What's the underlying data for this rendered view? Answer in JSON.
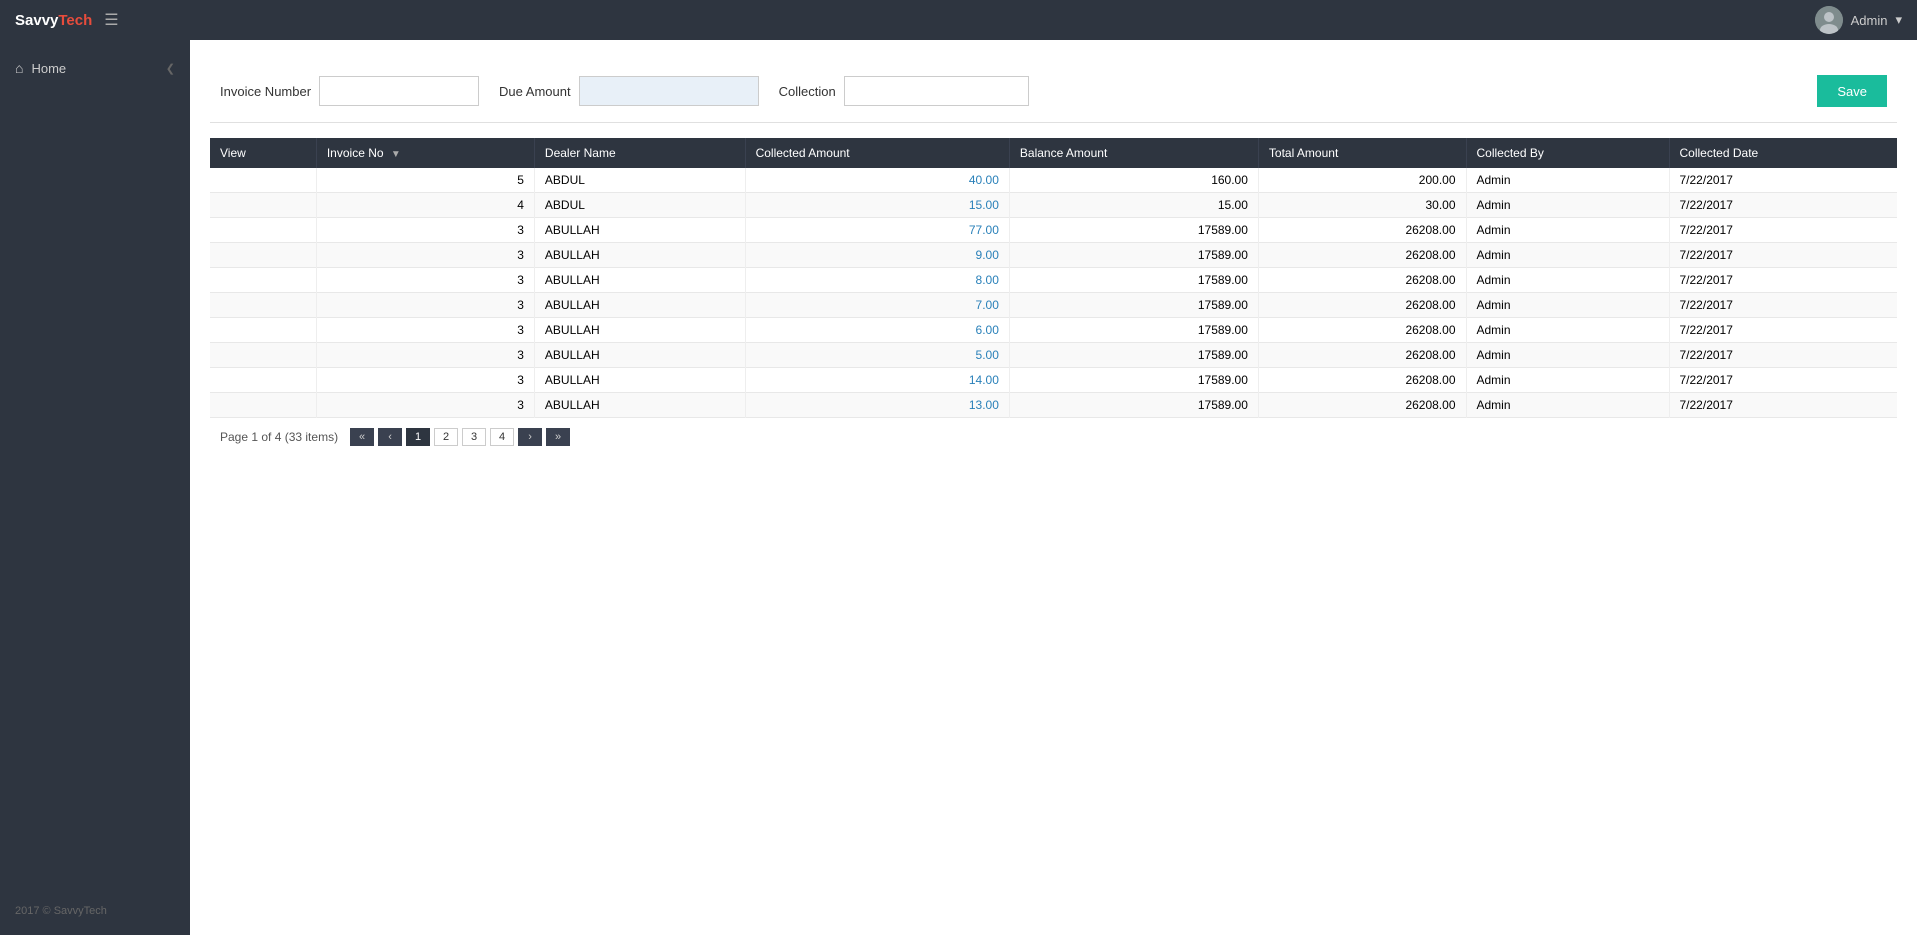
{
  "brand": {
    "savvy": "Savvy",
    "tech": "Tech"
  },
  "topnav": {
    "user": "Admin",
    "dropdown_arrow": "▾"
  },
  "sidebar": {
    "items": [
      {
        "label": "Home",
        "icon": "home"
      }
    ],
    "footer": "2017 © SavvyTech"
  },
  "form": {
    "invoice_number_label": "Invoice Number",
    "invoice_number_value": "",
    "invoice_number_placeholder": "",
    "due_amount_label": "Due Amount",
    "due_amount_value": "",
    "collection_label": "Collection",
    "collection_value": "",
    "save_button": "Save"
  },
  "table": {
    "columns": [
      "View",
      "Invoice No",
      "Dealer Name",
      "Collected Amount",
      "Balance Amount",
      "Total Amount",
      "Collected By",
      "Collected Date"
    ],
    "rows": [
      {
        "view": "",
        "invoice_no": "5",
        "dealer_name": "ABDUL",
        "collected_amount": "40.00",
        "balance_amount": "160.00",
        "total_amount": "200.00",
        "collected_by": "Admin",
        "collected_date": "7/22/2017"
      },
      {
        "view": "",
        "invoice_no": "4",
        "dealer_name": "ABDUL",
        "collected_amount": "15.00",
        "balance_amount": "15.00",
        "total_amount": "30.00",
        "collected_by": "Admin",
        "collected_date": "7/22/2017"
      },
      {
        "view": "",
        "invoice_no": "3",
        "dealer_name": "ABULLAH",
        "collected_amount": "77.00",
        "balance_amount": "17589.00",
        "total_amount": "26208.00",
        "collected_by": "Admin",
        "collected_date": "7/22/2017"
      },
      {
        "view": "",
        "invoice_no": "3",
        "dealer_name": "ABULLAH",
        "collected_amount": "9.00",
        "balance_amount": "17589.00",
        "total_amount": "26208.00",
        "collected_by": "Admin",
        "collected_date": "7/22/2017"
      },
      {
        "view": "",
        "invoice_no": "3",
        "dealer_name": "ABULLAH",
        "collected_amount": "8.00",
        "balance_amount": "17589.00",
        "total_amount": "26208.00",
        "collected_by": "Admin",
        "collected_date": "7/22/2017"
      },
      {
        "view": "",
        "invoice_no": "3",
        "dealer_name": "ABULLAH",
        "collected_amount": "7.00",
        "balance_amount": "17589.00",
        "total_amount": "26208.00",
        "collected_by": "Admin",
        "collected_date": "7/22/2017"
      },
      {
        "view": "",
        "invoice_no": "3",
        "dealer_name": "ABULLAH",
        "collected_amount": "6.00",
        "balance_amount": "17589.00",
        "total_amount": "26208.00",
        "collected_by": "Admin",
        "collected_date": "7/22/2017"
      },
      {
        "view": "",
        "invoice_no": "3",
        "dealer_name": "ABULLAH",
        "collected_amount": "5.00",
        "balance_amount": "17589.00",
        "total_amount": "26208.00",
        "collected_by": "Admin",
        "collected_date": "7/22/2017"
      },
      {
        "view": "",
        "invoice_no": "3",
        "dealer_name": "ABULLAH",
        "collected_amount": "14.00",
        "balance_amount": "17589.00",
        "total_amount": "26208.00",
        "collected_by": "Admin",
        "collected_date": "7/22/2017"
      },
      {
        "view": "",
        "invoice_no": "3",
        "dealer_name": "ABULLAH",
        "collected_amount": "13.00",
        "balance_amount": "17589.00",
        "total_amount": "26208.00",
        "collected_by": "Admin",
        "collected_date": "7/22/2017"
      }
    ]
  },
  "pagination": {
    "info": "Page 1 of 4 (33 items)",
    "pages": [
      "1",
      "2",
      "3",
      "4"
    ],
    "current_page": "1"
  }
}
